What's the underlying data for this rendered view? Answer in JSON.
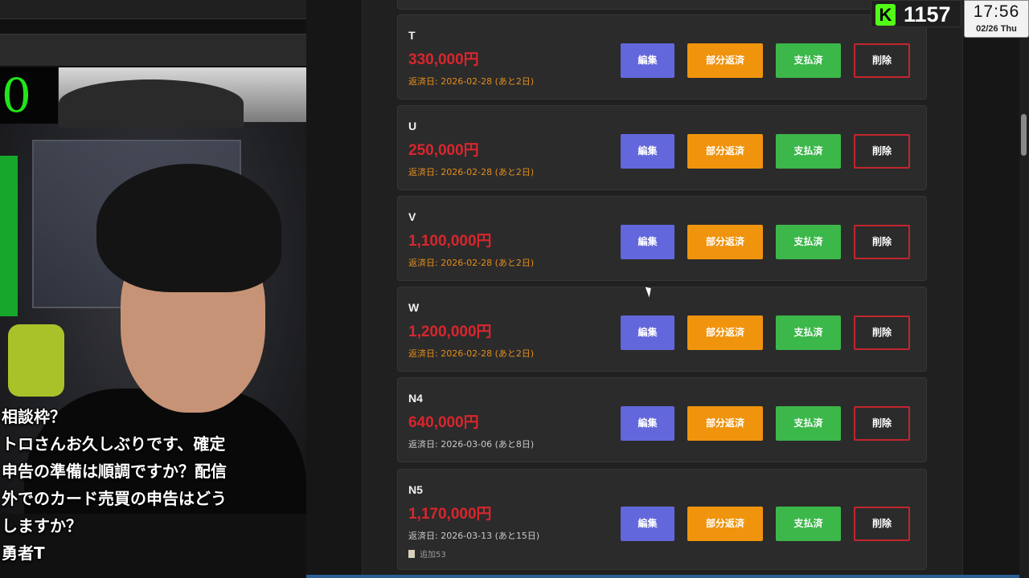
{
  "overlay": {
    "counter": "0",
    "viewer_count": "1157",
    "kick_logo": "K",
    "clock_time": "17:56",
    "clock_date": "02/26 Thu"
  },
  "chat": {
    "lines": [
      "相談枠？",
      "トロさんお久しぶりです、確定",
      "申告の準備は順調ですか？配信",
      "外でのカード売買の申告はどう",
      "しますか？",
      "勇者T"
    ]
  },
  "buttons": {
    "edit": "編集",
    "partial": "部分返済",
    "paid": "支払済",
    "delete": "削除"
  },
  "loans": [
    {
      "name": "T",
      "amount": "330,000円",
      "due": "返済日: 2026-02-28 (あと2日)",
      "due_status": "soon"
    },
    {
      "name": "U",
      "amount": "250,000円",
      "due": "返済日: 2026-02-28 (あと2日)",
      "due_status": "soon"
    },
    {
      "name": "V",
      "amount": "1,100,000円",
      "due": "返済日: 2026-02-28 (あと2日)",
      "due_status": "soon"
    },
    {
      "name": "W",
      "amount": "1,200,000円",
      "due": "返済日: 2026-02-28 (あと2日)",
      "due_status": "soon"
    },
    {
      "name": "N4",
      "amount": "640,000円",
      "due": "返済日: 2026-03-06 (あと8日)",
      "due_status": "normal"
    },
    {
      "name": "N5",
      "amount": "1,170,000円",
      "due": "返済日: 2026-03-13 (あと15日)",
      "due_status": "normal",
      "memo": "追加53"
    }
  ],
  "colors": {
    "amount": "#d8262d",
    "due_soon": "#e38d1d",
    "edit": "#6367dc",
    "partial": "#f0940d",
    "paid": "#3cb74a",
    "delete_border": "#c2262d"
  }
}
